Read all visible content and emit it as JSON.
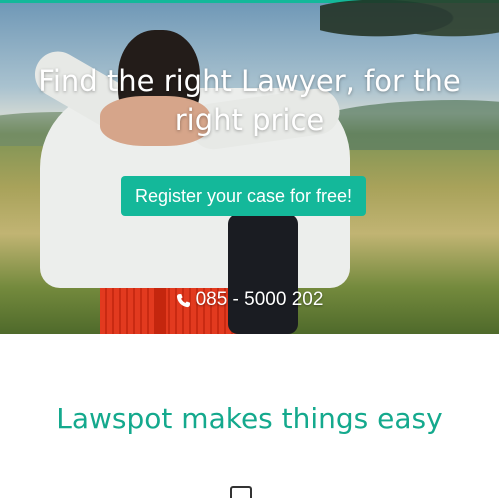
{
  "hero": {
    "title": "Find the right Lawyer, for the right price",
    "cta_label": "Register your case for free!",
    "phone": "085 - 5000 202",
    "phone_icon": "phone-icon"
  },
  "section": {
    "title": "Lawspot makes things easy",
    "feature_icon": "briefcase-icon"
  },
  "colors": {
    "accent": "#14b89a",
    "section_title": "#14a98d"
  }
}
